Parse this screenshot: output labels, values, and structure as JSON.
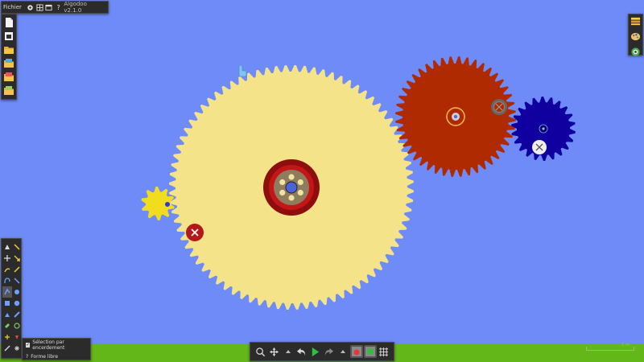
{
  "app": {
    "menu_label": "Fichier",
    "version": "Algodoo v2.1.0"
  },
  "menu_icons": [
    "gear-icon",
    "grid-icon",
    "window-icon",
    "help-icon"
  ],
  "menu_help_glyph": "?",
  "file_toolbar": [
    "new-scene-icon",
    "scene-browser-icon",
    "open-folder-icon",
    "open-shared-icon",
    "save-scene-icon",
    "save-as-icon"
  ],
  "right_toolbar": [
    "layers-icon",
    "palette-icon",
    "zoom-icon"
  ],
  "tools": [
    "drag-tool",
    "rotate-tool",
    "move-tool",
    "scale-tool",
    "cut-tool",
    "sketch-tool",
    "spring-tool",
    "box-tool",
    "circle-tool",
    "polygon-tool",
    "brush-tool",
    "plane-tool",
    "chain-tool",
    "gear-tool",
    "fixate-tool",
    "hinge-tool",
    "tracer-tool",
    "thruster-tool",
    "laser-tool",
    "settings-tool"
  ],
  "options": {
    "select_label": "Sélection par encerdement",
    "select_checked": true,
    "free_shape_label": "Forme libre",
    "free_shape_glyph": "?"
  },
  "bottom_toolbar": [
    "zoom-fit-icon",
    "pan-icon",
    "speed-up-icon",
    "undo-icon",
    "play-icon",
    "redo-icon",
    "speed-down-icon",
    "gravity-icon",
    "air-friction-icon",
    "grid-toggle-icon"
  ],
  "scale_label": "1 m",
  "colors": {
    "sky": "#6e8bf7",
    "ground": "#63b719",
    "big_gear": "#f5e38a",
    "red_gear": "#b02a00",
    "blue_gear": "#1000a0",
    "small_gear": "#f2dc1e"
  }
}
